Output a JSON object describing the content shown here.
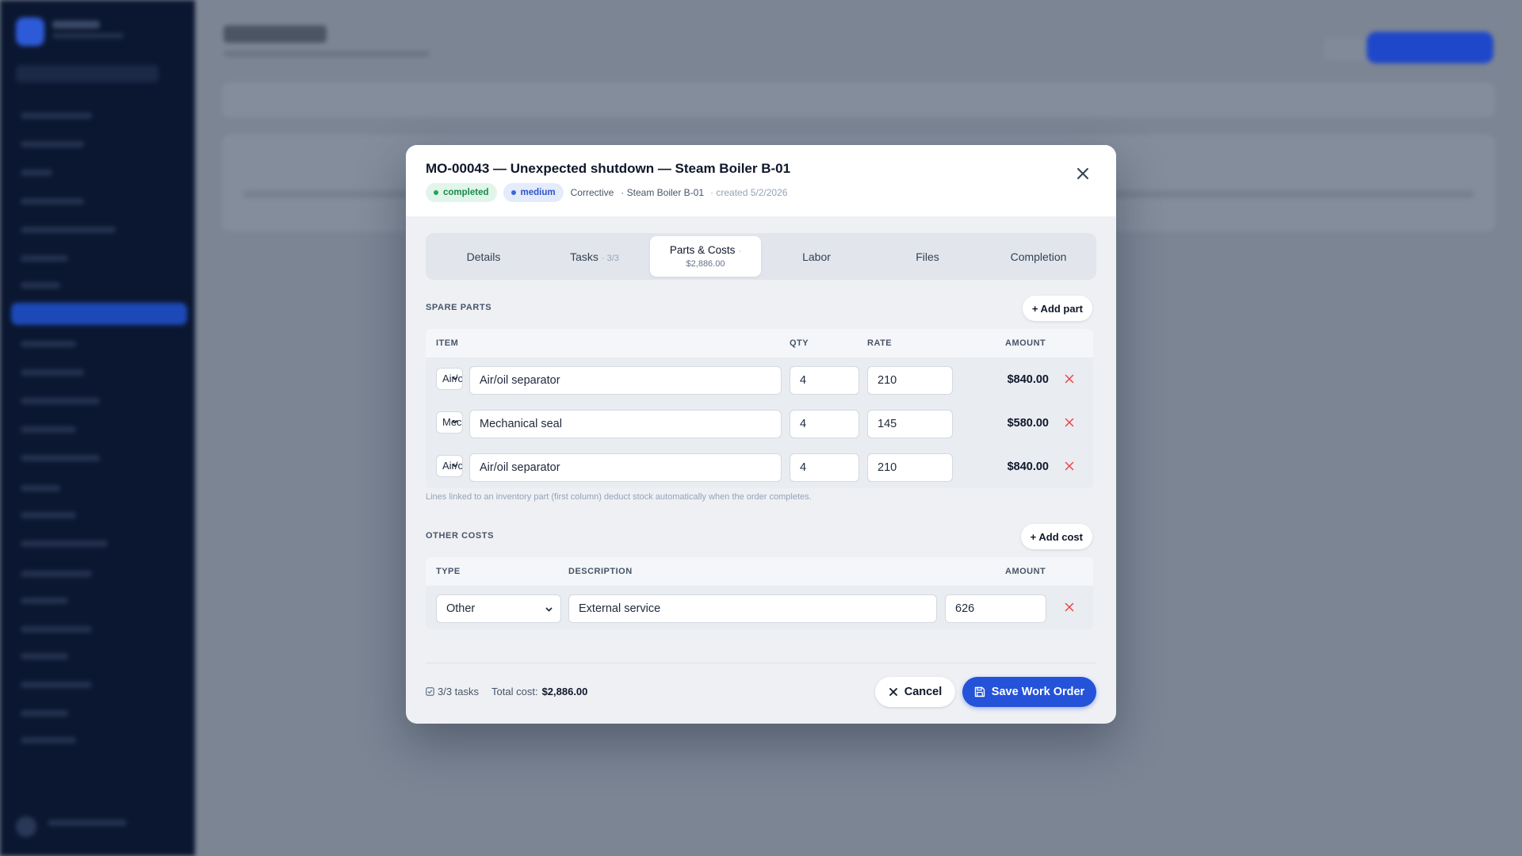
{
  "modal": {
    "title": "MO-00043 — Unexpected shutdown — Steam Boiler B-01",
    "status": "completed",
    "priority": "medium",
    "type": "Corrective",
    "asset": "· Steam Boiler B-01",
    "created": "· created 5/2/2026",
    "colors": {
      "accent": "#2453d9",
      "status_green": "#178a47",
      "priority_blue": "#2f55c9",
      "delete_red": "#ef4444"
    }
  },
  "tabs": [
    {
      "label": "Details",
      "count": ""
    },
    {
      "label": "Tasks",
      "count": "· 3/3"
    },
    {
      "label": "Parts & Costs",
      "count": "·",
      "sub": "$2,886.00"
    },
    {
      "label": "Labor",
      "count": ""
    },
    {
      "label": "Files",
      "count": ""
    },
    {
      "label": "Completion",
      "count": ""
    }
  ],
  "spare_parts": {
    "heading": "SPARE PARTS",
    "add_label": "+ Add part",
    "columns": {
      "item": "ITEM",
      "qty": "QTY",
      "rate": "RATE",
      "amount": "AMOUNT"
    },
    "rows": [
      {
        "part_select": "Air/oil separator",
        "item": "Air/oil separator",
        "qty": "4",
        "rate": "210",
        "amount": "$840.00"
      },
      {
        "part_select": "Mechanical seal",
        "item": "Mechanical seal",
        "qty": "4",
        "rate": "145",
        "amount": "$580.00"
      },
      {
        "part_select": "Air/oil separator",
        "item": "Air/oil separator",
        "qty": "4",
        "rate": "210",
        "amount": "$840.00"
      }
    ],
    "note": "Lines linked to an inventory part (first column) deduct stock automatically when the order completes."
  },
  "other_costs": {
    "heading": "OTHER COSTS",
    "add_label": "+ Add cost",
    "columns": {
      "type": "TYPE",
      "description": "DESCRIPTION",
      "amount": "AMOUNT"
    },
    "rows": [
      {
        "type": "Other",
        "description": "External service",
        "amount": "626"
      }
    ]
  },
  "footer": {
    "tasks": "3/3 tasks",
    "total_label": "Total cost:",
    "total_value": "$2,886.00",
    "cancel_label": "Cancel",
    "save_label": "Save Work Order"
  }
}
